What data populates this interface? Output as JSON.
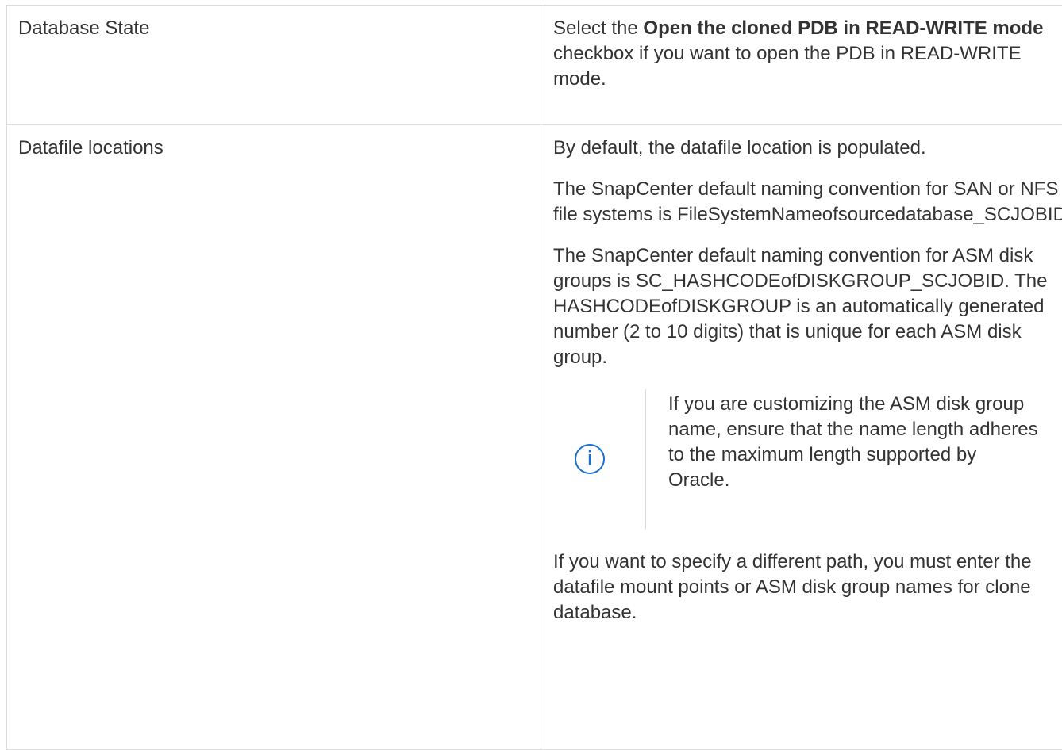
{
  "rows": [
    {
      "field": "Database State",
      "desc": {
        "prefix": "Select the ",
        "bold": "Open the cloned PDB in READ-WRITE mode",
        "suffix": " checkbox if you want to open the PDB in READ-WRITE mode."
      }
    },
    {
      "field": "Datafile locations",
      "paragraphs": [
        "By default, the datafile location is populated.",
        "The SnapCenter default naming convention for SAN or NFS file systems is FileSystemNameofsourcedatabase_SCJOBID.",
        "The SnapCenter default naming convention for ASM disk groups is SC_HASHCODEofDISKGROUP_SCJOBID. The HASHCODEofDISKGROUP is an automatically generated number (2 to 10 digits) that is unique for each ASM disk group."
      ],
      "note": {
        "icon": "info-icon",
        "icon_glyph": "i",
        "text": "If you are customizing the ASM disk group name, ensure that the name length adheres to the maximum length supported by Oracle."
      },
      "closing": "If you want to specify a different path, you must enter the datafile mount points or ASM disk group names for clone database."
    }
  ],
  "colors": {
    "text": "#333333",
    "border": "#dcdcdc",
    "info_accent": "#1a6fcf"
  }
}
